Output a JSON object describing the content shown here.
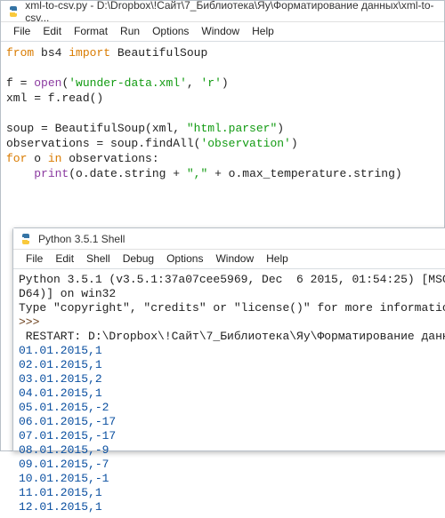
{
  "editor": {
    "title": "xml-to-csv.py - D:\\Dropbox\\!Сайт\\7_Библиотека\\Яу\\Форматирование данных\\xml-to-csv...",
    "menu": [
      "File",
      "Edit",
      "Format",
      "Run",
      "Options",
      "Window",
      "Help"
    ],
    "lines": {
      "l1_from": "from",
      "l1_bs4": " bs4 ",
      "l1_import": "import",
      "l1_rest": " BeautifulSoup",
      "l3_a": "f = ",
      "l3_open": "open",
      "l3_b": "(",
      "l3_str1": "'wunder-data.xml'",
      "l3_c": ", ",
      "l3_str2": "'r'",
      "l3_d": ")",
      "l4": "xml = f.read()",
      "l6_a": "soup = BeautifulSoup(xml, ",
      "l6_str": "\"html.parser\"",
      "l6_b": ")",
      "l7_a": "observations = soup.findAll(",
      "l7_str": "'observation'",
      "l7_b": ")",
      "l8_for": "for",
      "l8_mid": " o ",
      "l8_in": "in",
      "l8_rest": " observations:",
      "l9_indent": "    ",
      "l9_print": "print",
      "l9_a": "(o.date.string + ",
      "l9_str": "\",\"",
      "l9_b": " + o.max_temperature.string)"
    }
  },
  "shell": {
    "title": "Python 3.5.1 Shell",
    "menu": [
      "File",
      "Edit",
      "Shell",
      "Debug",
      "Options",
      "Window",
      "Help"
    ],
    "header1": "Python 3.5.1 (v3.5.1:37a07cee5969, Dec  6 2015, 01:54:25) [MSC",
    "header2": "D64)] on win32",
    "header3": "Type \"copyright\", \"credits\" or \"license()\" for more informatio",
    "prompt": ">>>",
    "restart": " RESTART: D:\\Dropbox\\!Сайт\\7_Библиотека\\Яу\\Форматирование данн",
    "output": [
      "01.01.2015,1",
      "02.01.2015,1",
      "03.01.2015,2",
      "04.01.2015,1",
      "05.01.2015,-2",
      "06.01.2015,-17",
      "07.01.2015,-17",
      "08.01.2015,-9",
      "09.01.2015,-7",
      "10.01.2015,-1",
      "11.01.2015,1",
      "12.01.2015,1"
    ]
  }
}
